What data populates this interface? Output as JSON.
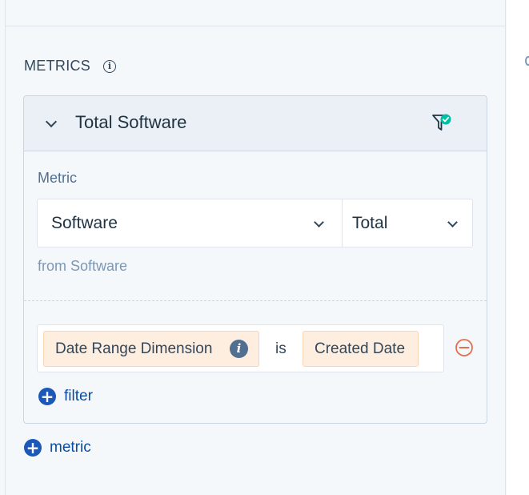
{
  "section": {
    "title": "METRICS",
    "info_icon": "info-circle-icon"
  },
  "metric_card": {
    "title": "Total Software",
    "collapse_icon": "chevron-down-icon",
    "filter_status_icon": "filter-check-icon",
    "metric_label": "Metric",
    "metric_select": {
      "value": "Software"
    },
    "aggregation_select": {
      "value": "Total"
    },
    "source_text": "from Software",
    "filter": {
      "dimension": "Date Range Dimension",
      "operator": "is",
      "value": "Created Date"
    },
    "add_filter_label": "filter"
  },
  "add_metric_label": "metric",
  "colors": {
    "accent": "#0b4da2",
    "chip_bg": "#fdeedf",
    "remove": "#e66e50",
    "check": "#00bda5"
  }
}
